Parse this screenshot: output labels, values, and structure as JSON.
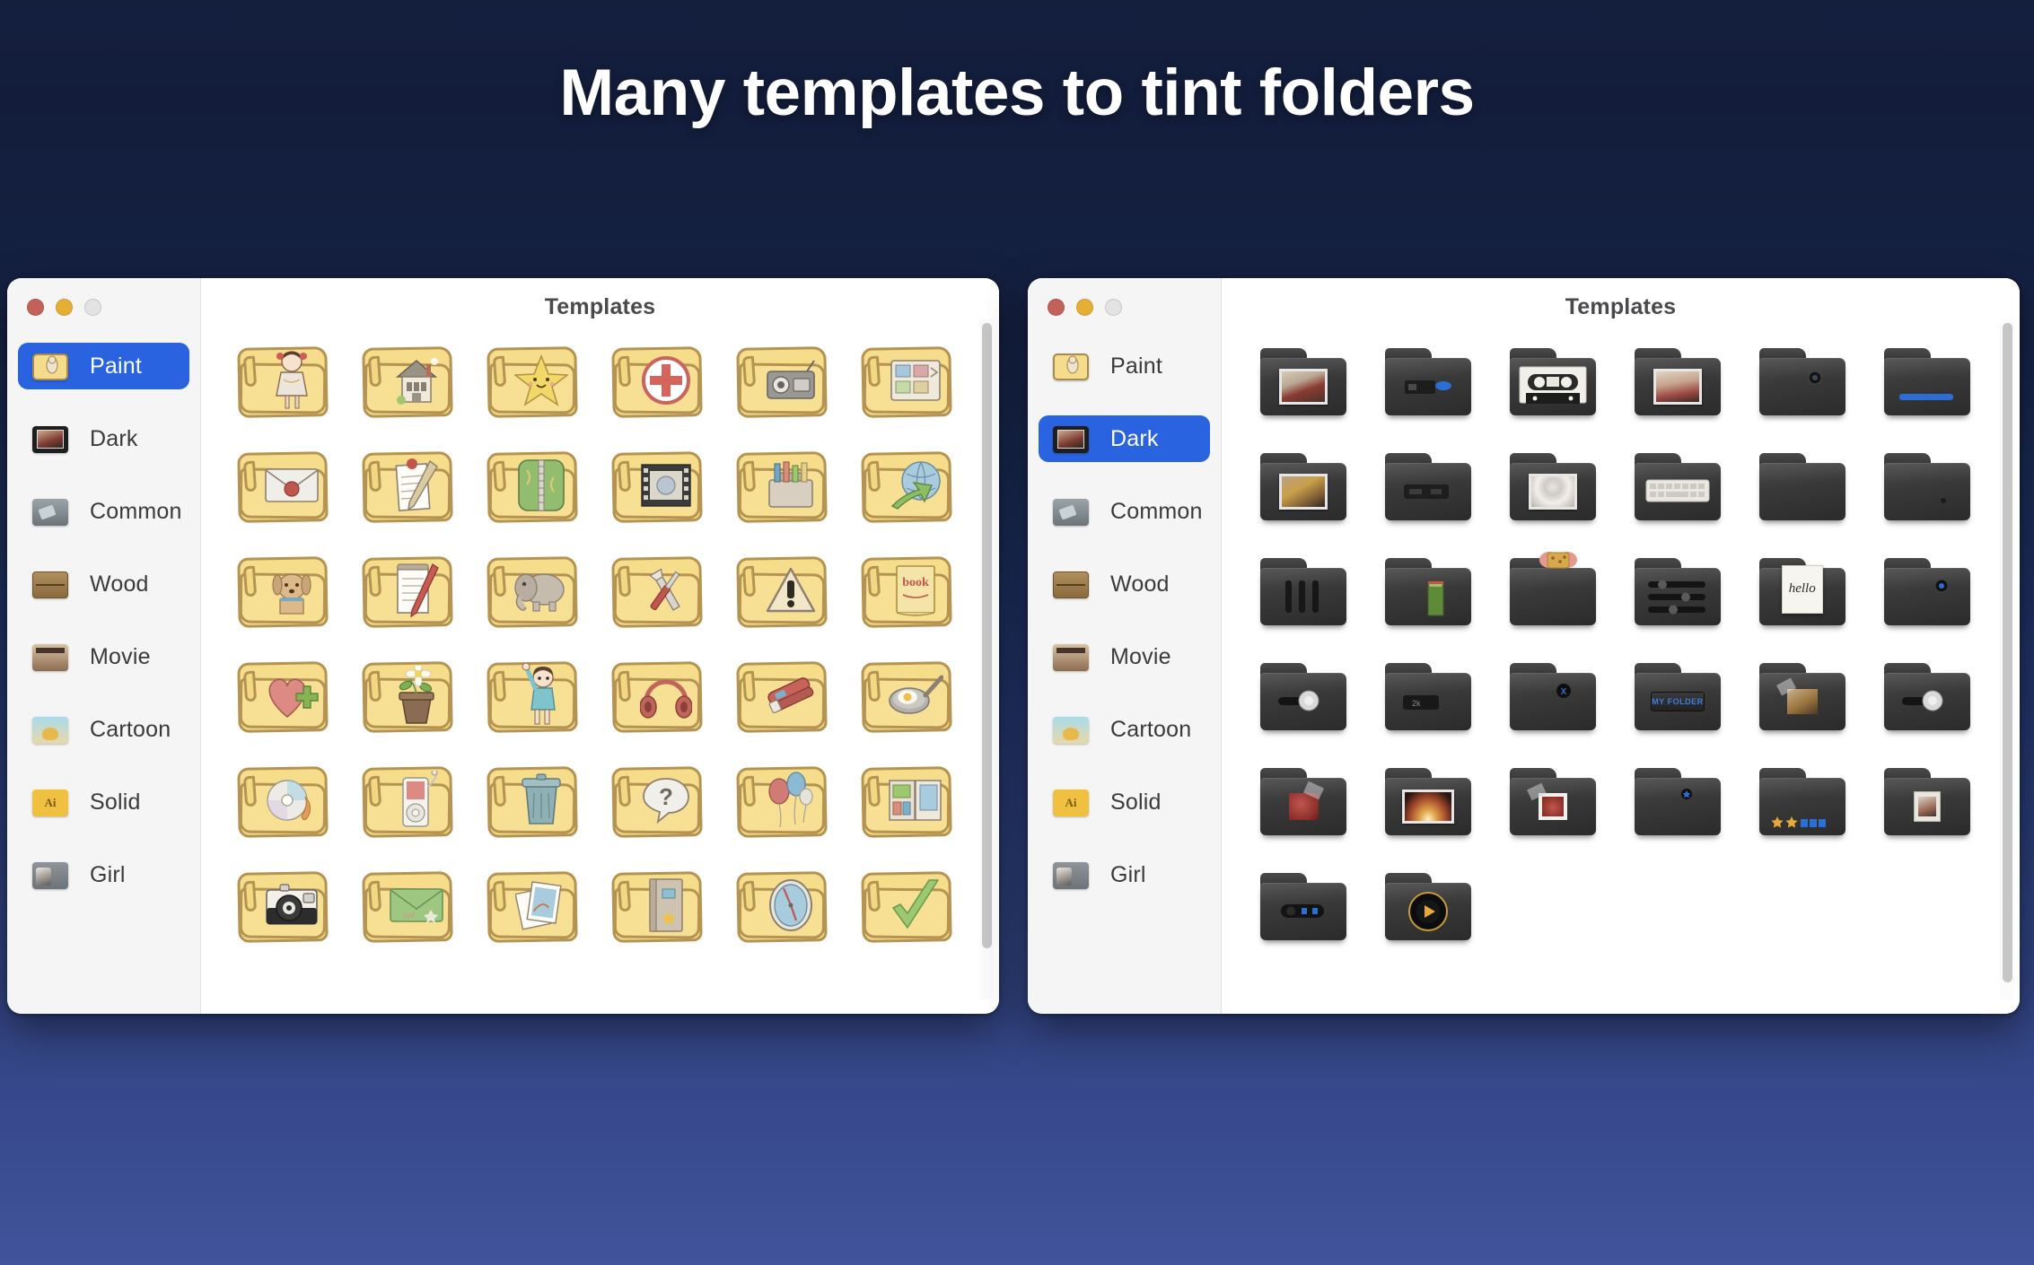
{
  "headline": "Many templates to tint folders",
  "colors": {
    "accent": "#2a63e0",
    "background_top": "#141f3e",
    "background_bottom": "#41539a",
    "window_bg": "#f6f6f6",
    "content_bg": "#ffffff",
    "traffic_red": "#c4605a",
    "traffic_yellow": "#e5ae35",
    "traffic_gray": "#e3e3e3",
    "title_text": "#4a4a4c",
    "nav_text": "#3a3a3c"
  },
  "windows": [
    {
      "id": "left",
      "pane_title": "Templates",
      "traffic_lights": [
        "close",
        "minimize",
        "zoom"
      ],
      "selected_item": "Paint",
      "sidebar": {
        "items": [
          {
            "label": "Paint",
            "icon": "paint-folder-icon",
            "selected": true
          },
          {
            "label": "Dark",
            "icon": "dark-folder-icon",
            "selected": false
          },
          {
            "label": "Common",
            "icon": "common-folder-icon",
            "selected": false
          },
          {
            "label": "Wood",
            "icon": "wood-folder-icon",
            "selected": false
          },
          {
            "label": "Movie",
            "icon": "movie-folder-icon",
            "selected": false
          },
          {
            "label": "Cartoon",
            "icon": "cartoon-folder-icon",
            "selected": false
          },
          {
            "label": "Solid",
            "icon": "solid-folder-icon",
            "selected": false
          },
          {
            "label": "Girl",
            "icon": "girl-folder-icon",
            "selected": false
          }
        ]
      },
      "grid": {
        "columns": 6,
        "rows": 6,
        "style": "paint",
        "items": [
          "girl-doll",
          "house",
          "star-smile",
          "red-cross",
          "camera-radio",
          "scrapbook",
          "sealed-envelope",
          "clipboard-pencil",
          "green-zipper",
          "film-frame",
          "toolbox",
          "globe-arrow",
          "dog",
          "notepad-pen",
          "elephant",
          "wrench-screwdriver",
          "warning-sign",
          "book",
          "heart-plus",
          "flower-pot",
          "kid-waving",
          "headphones",
          "stapler",
          "frying-pan-egg",
          "burning-cd",
          "ipod",
          "trash-bin",
          "question-bubble",
          "balloons",
          "photo-album",
          "film-camera",
          "green-envelope",
          "photo-stack",
          "notebook",
          "compass-clock",
          "green-check"
        ]
      }
    },
    {
      "id": "right",
      "pane_title": "Templates",
      "traffic_lights": [
        "close",
        "minimize",
        "zoom"
      ],
      "selected_item": "Dark",
      "sidebar": {
        "items": [
          {
            "label": "Paint",
            "icon": "paint-folder-icon",
            "selected": false
          },
          {
            "label": "Dark",
            "icon": "dark-folder-icon",
            "selected": true
          },
          {
            "label": "Common",
            "icon": "common-folder-icon",
            "selected": false
          },
          {
            "label": "Wood",
            "icon": "wood-folder-icon",
            "selected": false
          },
          {
            "label": "Movie",
            "icon": "movie-folder-icon",
            "selected": false
          },
          {
            "label": "Cartoon",
            "icon": "cartoon-folder-icon",
            "selected": false
          },
          {
            "label": "Solid",
            "icon": "solid-folder-icon",
            "selected": false
          },
          {
            "label": "Girl",
            "icon": "girl-folder-icon",
            "selected": false
          }
        ]
      },
      "grid": {
        "columns": 6,
        "rows": 6,
        "style": "dark",
        "items": [
          "portrait-photo",
          "usb-drive-blue",
          "cassette-tape",
          "doll-portrait",
          "lens-dot",
          "blue-bar",
          "gold-figures-photo",
          "card-slot",
          "anime-face",
          "keyboard",
          "plain-dark",
          "tiny-dot",
          "three-slots",
          "green-book",
          "cookies-peek",
          "equalizer",
          "hello-note",
          "blue-lens",
          "dial-knob",
          "label-tag",
          "blue-x-badge",
          "my-folder-label",
          "taped-photo",
          "dial-knob-2",
          "red-taped-photo",
          "fire-photo",
          "red-flower-photo",
          "blue-star-dot",
          "stars-rating",
          "jar-label",
          "camera-module",
          "play-dial"
        ],
        "labels": {
          "hello_note": "hello",
          "my_folder": "MY FOLDER"
        }
      }
    }
  ]
}
